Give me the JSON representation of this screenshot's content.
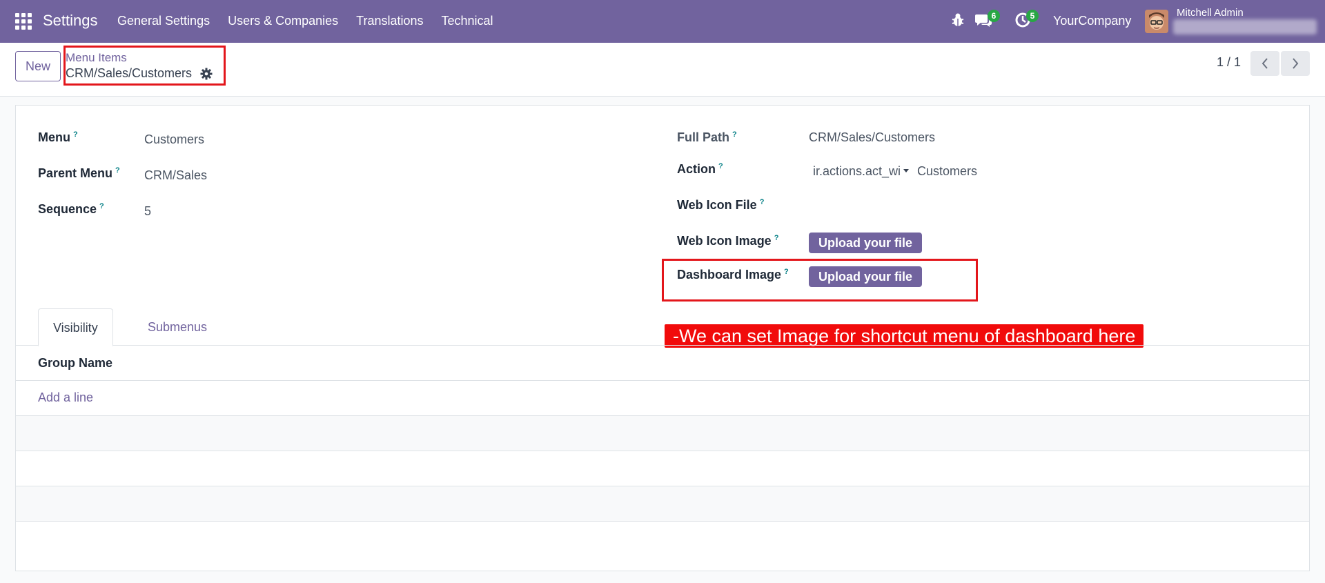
{
  "navbar": {
    "app_title": "Settings",
    "menu": [
      "General Settings",
      "Users & Companies",
      "Translations",
      "Technical"
    ],
    "messages_count": "6",
    "activities_count": "5",
    "company": "YourCompany",
    "user_name": "Mitchell Admin",
    "icons": [
      "apps-grid-icon",
      "bug-icon",
      "chat-icon",
      "clock-icon"
    ]
  },
  "control_panel": {
    "new_label": "New",
    "breadcrumb_parent": "Menu Items",
    "breadcrumb_current": "CRM/Sales/Customers",
    "pager": "1 / 1"
  },
  "form": {
    "left": {
      "menu_label": "Menu",
      "menu_value": "Customers",
      "parent_label": "Parent Menu",
      "parent_value": "CRM/Sales",
      "sequence_label": "Sequence",
      "sequence_value": "5"
    },
    "right": {
      "full_path_label": "Full Path",
      "full_path_value": "CRM/Sales/Customers",
      "action_label": "Action",
      "action_type": "ir.actions.act_wi",
      "action_value": "Customers",
      "web_icon_file_label": "Web Icon File",
      "web_icon_image_label": "Web Icon Image",
      "dashboard_image_label": "Dashboard Image",
      "upload_label": "Upload your file"
    },
    "tooltip_mark": "?",
    "annotation": "-We can set Image for shortcut menu of dashboard here",
    "tabs": [
      "Visibility",
      "Submenus"
    ],
    "table": {
      "column": "Group Name",
      "add_line": "Add a line"
    }
  },
  "colors": {
    "brand": "#71639e",
    "annotation_red": "#e3161b",
    "badge_green": "#28a745"
  }
}
